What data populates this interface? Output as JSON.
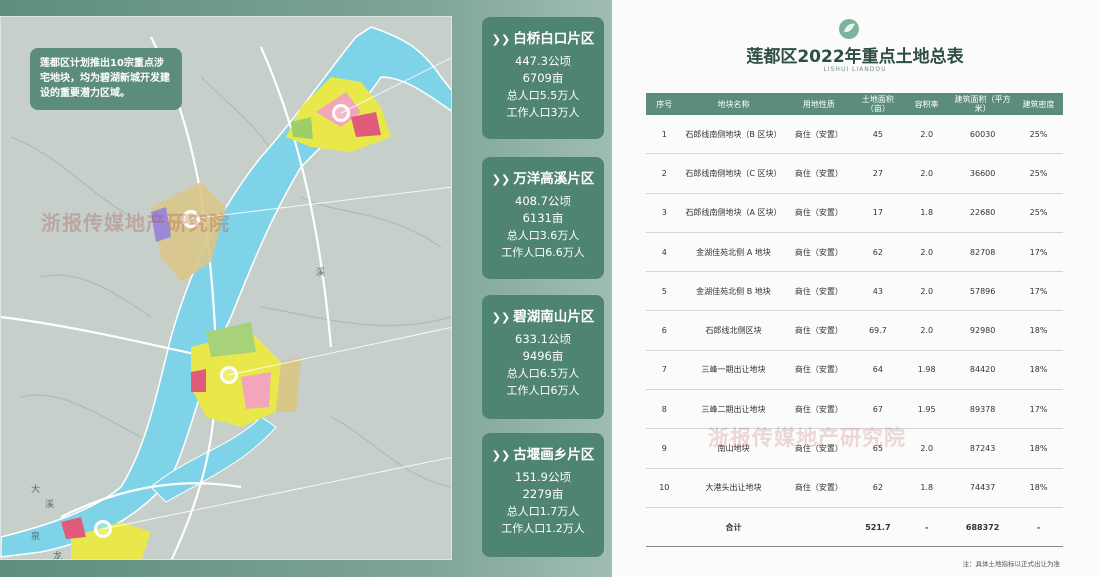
{
  "map": {
    "intro": "莲都区计划推出10宗重点涉宅地块，均为碧湖新城开发建设的重要潜力区域。",
    "watermark": "浙报传媒地产研究院",
    "place_labels": [
      "溪",
      "大",
      "溪",
      "泉",
      "龙"
    ]
  },
  "cards": [
    {
      "title": "白桥白口片区",
      "area_ha": "447.3公顷",
      "area_mu": "6709亩",
      "pop_total": "总人口5.5万人",
      "pop_work": "工作人口3万人"
    },
    {
      "title": "万洋高溪片区",
      "area_ha": "408.7公顷",
      "area_mu": "6131亩",
      "pop_total": "总人口3.6万人",
      "pop_work": "工作人口6.6万人"
    },
    {
      "title": "碧湖南山片区",
      "area_ha": "633.1公顷",
      "area_mu": "9496亩",
      "pop_total": "总人口6.5万人",
      "pop_work": "工作人口6万人"
    },
    {
      "title": "古堰画乡片区",
      "area_ha": "151.9公顷",
      "area_mu": "2279亩",
      "pop_total": "总人口1.7万人",
      "pop_work": "工作人口1.2万人"
    }
  ],
  "table_panel": {
    "title": "莲都区2022年重点土地总表",
    "subtitle": "LISHUI LIANDOU",
    "watermark": "浙报传媒地产研究院",
    "headers": [
      "序号",
      "地块名称",
      "用地性质",
      "土地面积（亩）",
      "容积率",
      "建筑面积（平方米）",
      "建筑密度"
    ],
    "rows": [
      [
        "1",
        "石郎线南侧地块（B 区块）",
        "商住（安置）",
        "45",
        "2.0",
        "60030",
        "25%"
      ],
      [
        "2",
        "石郎线南侧地块（C 区块）",
        "商住（安置）",
        "27",
        "2.0",
        "36600",
        "25%"
      ],
      [
        "3",
        "石郎线南侧地块（A 区块）",
        "商住（安置）",
        "17",
        "1.8",
        "22680",
        "25%"
      ],
      [
        "4",
        "金湖佳苑北侧 A 地块",
        "商住（安置）",
        "62",
        "2.0",
        "82708",
        "17%"
      ],
      [
        "5",
        "金湖佳苑北侧 B 地块",
        "商住（安置）",
        "43",
        "2.0",
        "57896",
        "17%"
      ],
      [
        "6",
        "石郎线北侧区块",
        "商住（安置）",
        "69.7",
        "2.0",
        "92980",
        "18%"
      ],
      [
        "7",
        "三峰一期出让地块",
        "商住（安置）",
        "64",
        "1.98",
        "84420",
        "18%"
      ],
      [
        "8",
        "三峰二期出让地块",
        "商住（安置）",
        "67",
        "1.95",
        "89378",
        "17%"
      ],
      [
        "9",
        "南山地块",
        "商住（安置）",
        "65",
        "2.0",
        "87243",
        "18%"
      ],
      [
        "10",
        "大港头出让地块",
        "商住（安置）",
        "62",
        "1.8",
        "74437",
        "18%"
      ]
    ],
    "total": [
      "",
      "合计",
      "",
      "521.7",
      "-",
      "688372",
      "-"
    ],
    "note": "注：具体土地指标以正式出让为准"
  },
  "colors": {
    "card_bg": "#4f8471",
    "header_bg": "#5b8c7c",
    "river": "#7fd3e8",
    "title": "#2f4e43"
  }
}
